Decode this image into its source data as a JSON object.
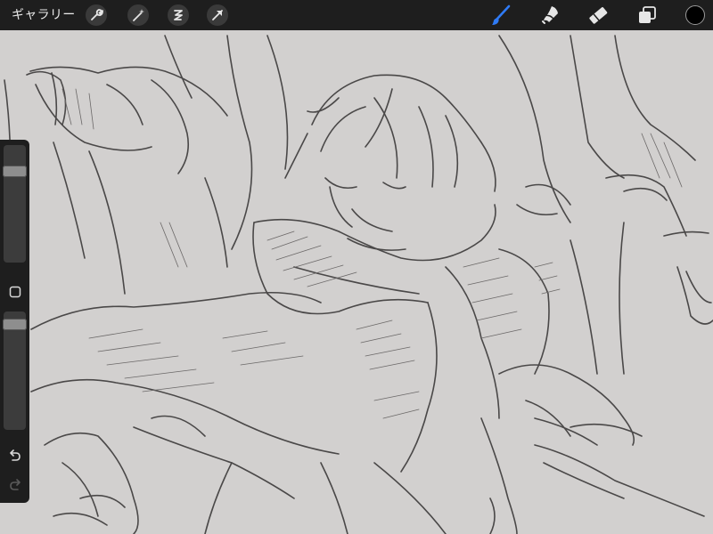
{
  "toolbar": {
    "gallery_label": "ギャラリー",
    "left_tools": [
      "wrench-icon",
      "magic-wand-icon",
      "selection-icon",
      "transform-arrow-icon"
    ],
    "right_tools": [
      "brush-icon",
      "smudge-icon",
      "eraser-icon",
      "layers-icon"
    ],
    "active_tool": "brush-icon",
    "active_color": "#000000",
    "accent_color": "#2f7bf6"
  },
  "sidebar": {
    "brush_size": 0.81,
    "opacity": 0.93,
    "modify_button": "modify-square-icon",
    "undo": "undo-icon",
    "redo": "redo-icon"
  },
  "canvas": {
    "background": "#d2d0cf",
    "stroke_color": "#4a4848"
  }
}
